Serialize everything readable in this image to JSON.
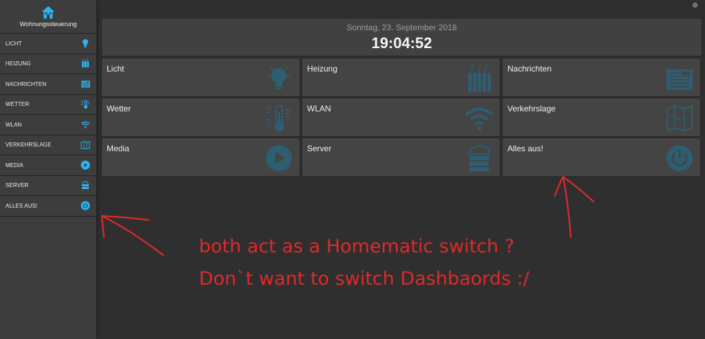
{
  "sidebar": {
    "brand_icon": "house-icon",
    "title": "Wohnungssteuerung",
    "items": [
      {
        "label": "LICHT",
        "icon": "lightbulb-icon"
      },
      {
        "label": "HEIZUNG",
        "icon": "radiator-icon"
      },
      {
        "label": "NACHRICHTEN",
        "icon": "newspaper-icon"
      },
      {
        "label": "WETTER",
        "icon": "thermometer-sun-icon"
      },
      {
        "label": "WLAN",
        "icon": "wifi-icon"
      },
      {
        "label": "VERKEHRSLAGE",
        "icon": "map-icon"
      },
      {
        "label": "MEDIA",
        "icon": "play-icon"
      },
      {
        "label": "SERVER",
        "icon": "server-icon"
      },
      {
        "label": "ALLES AUS!",
        "icon": "power-icon"
      }
    ]
  },
  "header": {
    "date": "Sonntag, 23. September 2018",
    "time": "19:04:52"
  },
  "tiles": [
    {
      "label": "Licht",
      "icon": "lightbulb-icon"
    },
    {
      "label": "Heizung",
      "icon": "radiator-icon"
    },
    {
      "label": "Nachrichten",
      "icon": "newspaper-icon"
    },
    {
      "label": "Wetter",
      "icon": "thermometer-sun-icon"
    },
    {
      "label": "WLAN",
      "icon": "wifi-icon"
    },
    {
      "label": "Verkehrslage",
      "icon": "map-icon"
    },
    {
      "label": "Media",
      "icon": "play-icon"
    },
    {
      "label": "Server",
      "icon": "server-icon"
    },
    {
      "label": "Alles aus!",
      "icon": "power-icon"
    }
  ],
  "annotation": {
    "line1": "both act as a Homematic switch ?",
    "line2": "Don`t want to switch Dashbaords :/"
  },
  "colors": {
    "accent": "#29b6f6",
    "tile_icon": "#2e5e72",
    "annotation": "#e02929",
    "background": "#2f2f2f",
    "sidebar": "#3d3d3d"
  }
}
